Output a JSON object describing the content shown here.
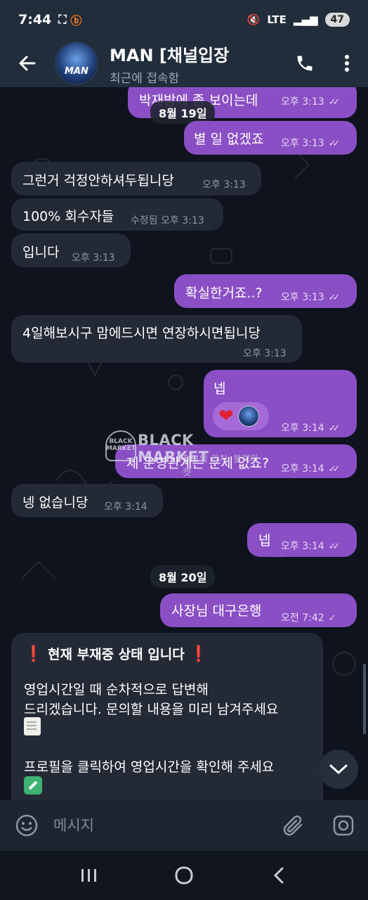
{
  "status_bar": {
    "time": "7:44",
    "network": "LTE",
    "battery": "47"
  },
  "header": {
    "title": "MAN [채널입장",
    "subtitle": "최근에 접속함",
    "avatar_text": "MAN"
  },
  "messages": [
    {
      "dir": "out",
      "text": "박재방에 좀 보이는데",
      "time": "오후 3:13",
      "ticks": "✓✓"
    },
    {
      "dir": "out",
      "text": "별 일 없겠죠",
      "time": "오후 3:13",
      "ticks": "✓✓"
    },
    {
      "dir": "in",
      "text": "그런거 걱정안하셔두됩니당",
      "time": "오후 3:13"
    },
    {
      "dir": "in",
      "text": "100% 회수자들",
      "time": "수정됨 오후 3:13"
    },
    {
      "dir": "in",
      "text": "입니다",
      "time": "오후 3:13"
    },
    {
      "dir": "out",
      "text": "확실한거죠..?",
      "time": "오후 3:13",
      "ticks": "✓✓"
    },
    {
      "dir": "in",
      "text": "4일해보시구 맘에드시면 연장하시면됩니당",
      "time": "오후 3:13"
    },
    {
      "dir": "out",
      "text": "넵",
      "time": "오후 3:14",
      "ticks": "✓✓",
      "reaction": "❤"
    },
    {
      "dir": "out",
      "text": "제 운영관계는 문제 없죠?",
      "time": "오후 3:14",
      "ticks": "✓✓"
    },
    {
      "dir": "in",
      "text": "넹 없습니당",
      "time": "오후 3:14"
    },
    {
      "dir": "out",
      "text": "넵",
      "time": "오후 3:14",
      "ticks": "✓✓"
    },
    {
      "dir": "out",
      "text": "사장님 대구은행",
      "time": "오전 7:42",
      "ticks": "✓"
    }
  ],
  "date_separators": [
    "8월 19일",
    "8월 20일"
  ],
  "auto_reply": {
    "title": "현재 부재중 상태 입니다",
    "line1": "영업시간일 때 순차적으로 답변해",
    "line2": "드리겠습니다. 문의할 내용을 미리 남겨주세요",
    "line3": "프로필을 클릭하여 영업시간을 확인해 주세요"
  },
  "watermark": {
    "main": "BLACK MARKET",
    "sub": "정보의 가치, 블랙마켓",
    "logo": "BLACK MARKET"
  },
  "input": {
    "placeholder": "메시지"
  },
  "icons": {
    "back": "arrow-left-icon",
    "call": "phone-icon",
    "menu": "more-vertical-icon",
    "emoji": "emoji-icon",
    "attach": "paperclip-icon",
    "camera": "camera-icon",
    "scroll": "chevron-down-icon"
  },
  "colors": {
    "outgoing_bubble": "#8a4fc4",
    "incoming_bubble": "#232a35",
    "header": "#212d3b"
  }
}
